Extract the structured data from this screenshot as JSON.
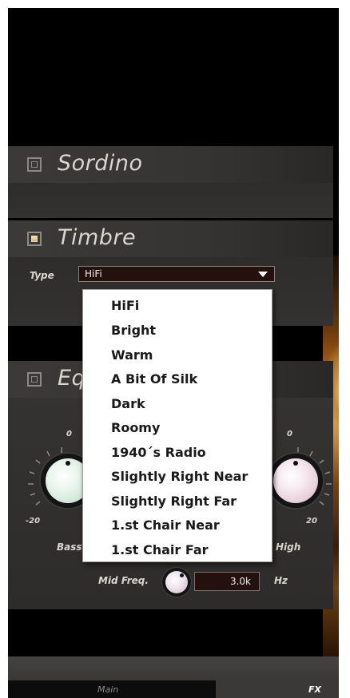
{
  "sections": {
    "sordino": {
      "title": "Sordino",
      "checked": false
    },
    "timbre": {
      "title": "Timbre",
      "checked": true,
      "type_label": "Type",
      "type_value": "HiFi"
    },
    "eq": {
      "title_partial": "Eq",
      "checked": false,
      "bass": {
        "label": "Bass",
        "tick_top": "0",
        "tick_left": "-20"
      },
      "high": {
        "label": "High",
        "tick_top": "0",
        "tick_right": "20"
      },
      "mid_freq": {
        "label": "Mid Freq.",
        "value": "3.0k",
        "unit": "Hz"
      }
    }
  },
  "dropdown": {
    "options": [
      "HiFi",
      "Bright",
      "Warm",
      "A Bit Of Silk",
      "Dark",
      "Roomy",
      "1940´s Radio",
      "Slightly Right Near",
      "Slightly Right Far",
      "1.st Chair Near",
      "1.st Chair Far"
    ]
  },
  "tabs": {
    "main": "Main",
    "fx": "FX",
    "active": "FX"
  },
  "colors": {
    "panel": "#343230",
    "checkbox_on": "#e8d6a8",
    "field_bg": "#24100c"
  }
}
